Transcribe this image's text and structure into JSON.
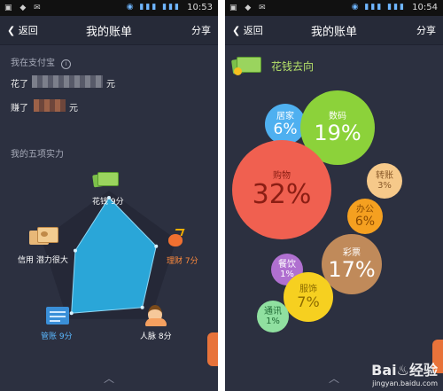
{
  "left": {
    "status": {
      "time": "10:53"
    },
    "nav": {
      "back": "返回",
      "title": "我的账单",
      "share": "分享"
    },
    "section1": {
      "title": "我在支付宝",
      "info_icon": "info-icon",
      "spent_prefix": "花了",
      "spent_suffix": "元",
      "earned_prefix": "赚了",
      "earned_suffix": "元"
    },
    "section2": {
      "title": "我的五项实力"
    },
    "radar": [
      {
        "label": "花钱 9分",
        "color": "#ffffff",
        "icon": "money-icon"
      },
      {
        "label": "理财 7分",
        "color": "#ff8a3c",
        "icon": "finance-bag-icon"
      },
      {
        "label": "人脉 8分",
        "color": "#ffffff",
        "icon": "people-icon"
      },
      {
        "label": "管账 9分",
        "color": "#5ab8ff",
        "icon": "ledger-icon"
      },
      {
        "label": "信用 潜力很大",
        "color": "#ffffff",
        "icon": "credit-card-icon"
      }
    ],
    "radar_scores": [
      9,
      7,
      8,
      9,
      5
    ]
  },
  "right": {
    "status": {
      "time": "10:54"
    },
    "nav": {
      "back": "返回",
      "title": "我的账单",
      "share": "分享"
    },
    "header": {
      "title": "花钱去向",
      "icon": "money-icon"
    },
    "bubbles": [
      {
        "label": "居家",
        "pct": "6%",
        "fill": "#4fb0f0",
        "text": "#ffffff"
      },
      {
        "label": "数码",
        "pct": "19%",
        "fill": "#8cd23a",
        "text": "#ffffff"
      },
      {
        "label": "转账",
        "pct": "3%",
        "fill": "#f6c98a",
        "text": "#8a5a2a"
      },
      {
        "label": "购物",
        "pct": "32%",
        "fill": "#f06050",
        "text": "#8b1e14"
      },
      {
        "label": "办公",
        "pct": "6%",
        "fill": "#f5a020",
        "text": "#8b4a00"
      },
      {
        "label": "彩票",
        "pct": "17%",
        "fill": "#c08a5a",
        "text": "#ffffff"
      },
      {
        "label": "餐饮",
        "pct": "1%",
        "fill": "#b070d0",
        "text": "#ffffff"
      },
      {
        "label": "服饰",
        "pct": "7%",
        "fill": "#f6d020",
        "text": "#8b6a00"
      },
      {
        "label": "通讯",
        "pct": "1%",
        "fill": "#90e0a0",
        "text": "#1f6a35"
      }
    ],
    "watermark": {
      "brand": "Bai♨经验",
      "url": "jingyan.baidu.com"
    }
  }
}
